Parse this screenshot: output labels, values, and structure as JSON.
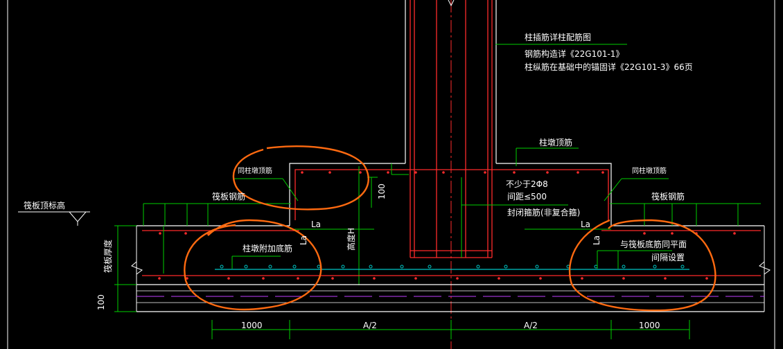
{
  "notes": {
    "line1": "柱插筋详柱配筋图",
    "line2": "钢筋构造详《22G101-1》",
    "line3": "柱纵筋在基础中的锚固详《22G101-3》66页"
  },
  "labels": {
    "raft_top_elevation": "筏板顶标高",
    "raft_rebar_left": "筏板钢筋",
    "raft_rebar_right": "筏板钢筋",
    "same_pier_top_left": "同柱墩顶筋",
    "same_pier_top_right": "同柱墩顶筋",
    "pier_top_bar": "柱墩顶筋",
    "stirrup_min": "不少于2Φ8",
    "stirrup_spacing": "间距≤500",
    "closed_stirrup": "封闭箍筋(非复合箍)",
    "pier_bottom_extra": "柱墩附加底筋",
    "same_as_raft_1": "与筏板底筋同平面",
    "same_as_raft_2": "间隔设置",
    "raft_thickness": "筏板厚度",
    "height_h": "高度H",
    "dim_100_top": "100",
    "dim_100_bottom": "100",
    "la_1": "La",
    "la_2": "La",
    "la_3": "La",
    "la_4": "La"
  },
  "dimensions": {
    "left": "1000",
    "mid_left": "A/2",
    "mid_right": "A/2",
    "right": "1000"
  },
  "colors": {
    "background": "#000000",
    "column": "#ff2b2b",
    "rebar_green": "#00d000",
    "outline_white": "#ffffff",
    "cyan": "#00c8c8",
    "magenta": "#c040ff",
    "annotation_orange": "#ff6a10"
  }
}
